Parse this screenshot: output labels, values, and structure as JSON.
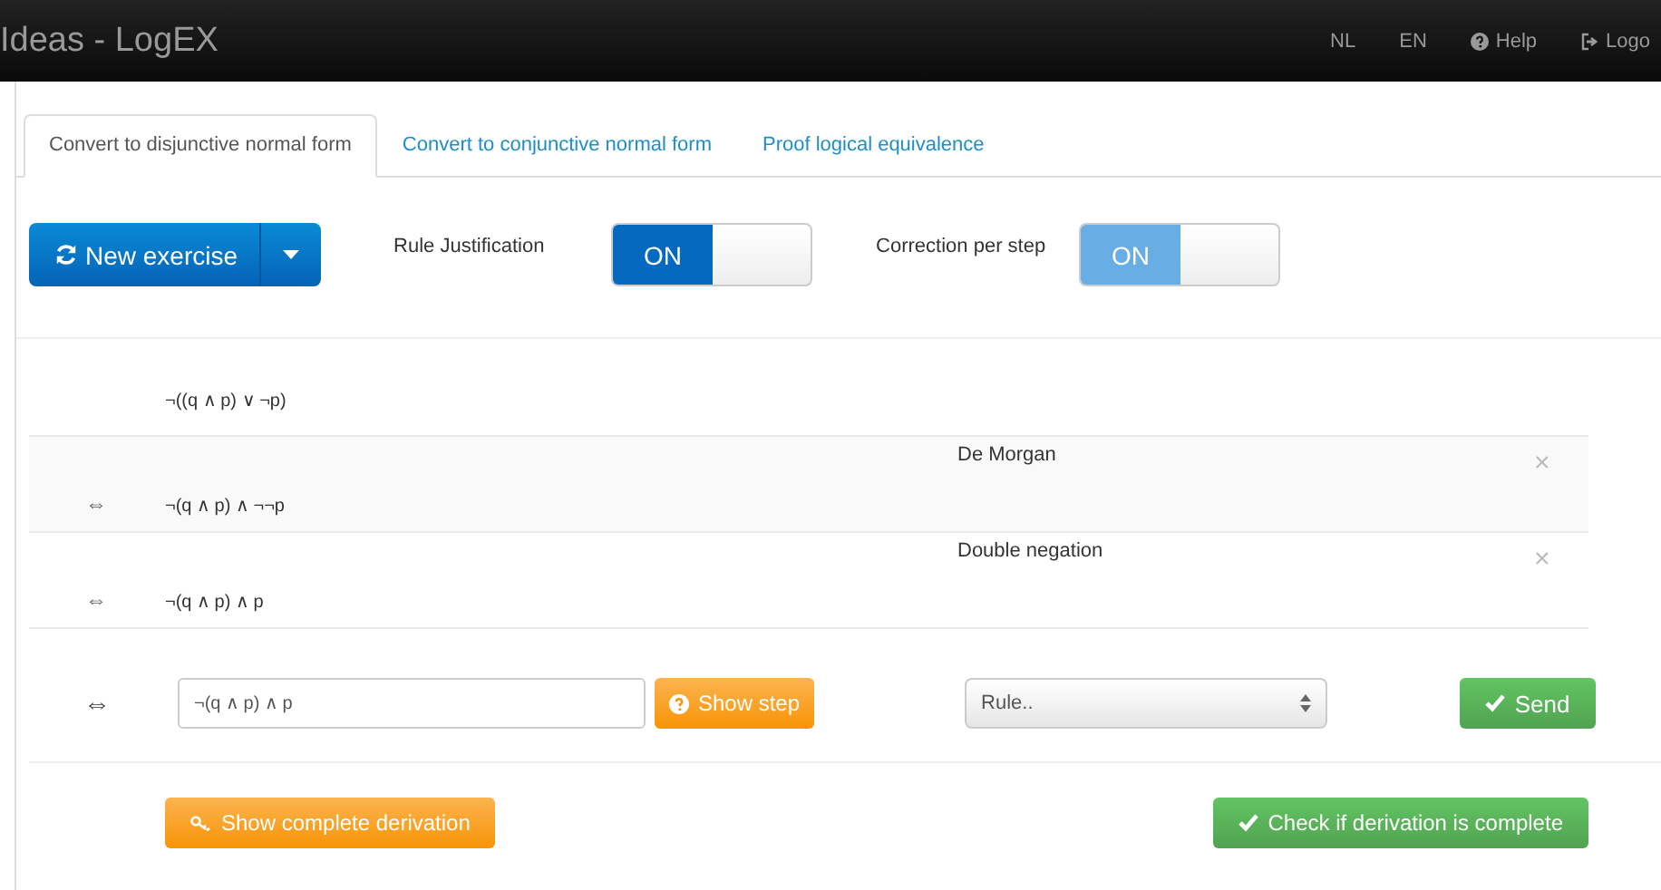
{
  "navbar": {
    "title": "Ideas - LogEX",
    "links": [
      {
        "label": "NL",
        "kind": "text"
      },
      {
        "label": "EN",
        "kind": "text"
      },
      {
        "label": "Help",
        "kind": "help"
      },
      {
        "label": "Logo",
        "kind": "logout"
      }
    ]
  },
  "tabs": [
    {
      "label": "Convert to disjunctive normal form",
      "selected": true
    },
    {
      "label": "Convert to conjunctive normal form",
      "selected": false
    },
    {
      "label": "Proof logical equivalence",
      "selected": false
    }
  ],
  "toolbar": {
    "new_exercise": "New exercise",
    "toggles": [
      {
        "label": "Rule Justification",
        "state": "ON",
        "on": true,
        "disabled": false
      },
      {
        "label": "Correction per step",
        "state": "ON",
        "on": true,
        "disabled": true
      }
    ]
  },
  "derivation": {
    "start": "¬((q ∧ p) ∨ ¬p)",
    "steps": [
      {
        "symbol": "⇔",
        "formula": "¬(q ∧ p) ∧ ¬¬p",
        "rule": "De Morgan",
        "close": "×"
      },
      {
        "symbol": "⇔",
        "formula": "¬(q ∧ p) ∧ p",
        "rule": "Double negation",
        "close": "×"
      }
    ]
  },
  "input_row": {
    "symbol": "⇔",
    "value": "¬(q ∧ p) ∧ p",
    "show_step": "Show step",
    "rule_placeholder": "Rule..",
    "send": "Send"
  },
  "footer": {
    "show_complete": "Show complete derivation",
    "check_complete": "Check if derivation is complete"
  }
}
